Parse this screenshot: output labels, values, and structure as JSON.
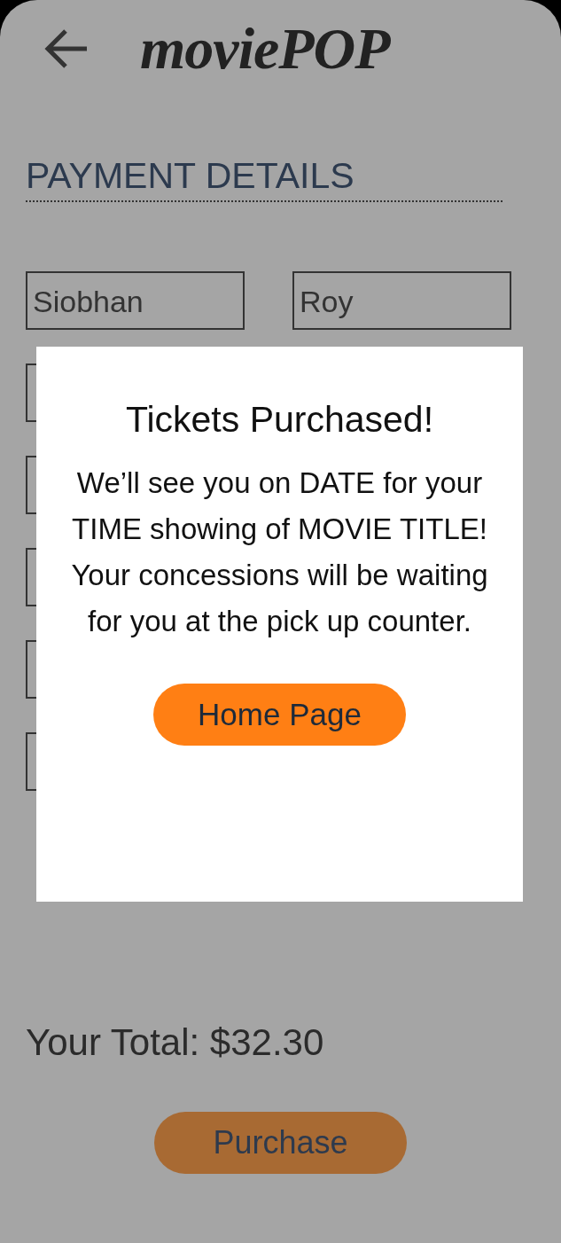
{
  "header": {
    "logo": "moviePOP"
  },
  "section_title": "PAYMENT DETAILS",
  "name_fields": [
    {
      "value": "Siobhan"
    },
    {
      "value": "Roy"
    }
  ],
  "covered_fields": [
    {
      "kind": "field"
    },
    {
      "kind": "field"
    },
    {
      "kind": "field"
    },
    {
      "kind": "field"
    },
    {
      "kind": "field"
    }
  ],
  "total": "Your Total: $32.30",
  "purchase_button": "Purchase",
  "dialog": {
    "title": "Tickets Purchased!",
    "message": "We’ll see you on DATE for your TIME showing of MOVIE TITLE! Your concessions will be waiting for you at the pick up counter.",
    "button": "Home Page"
  }
}
